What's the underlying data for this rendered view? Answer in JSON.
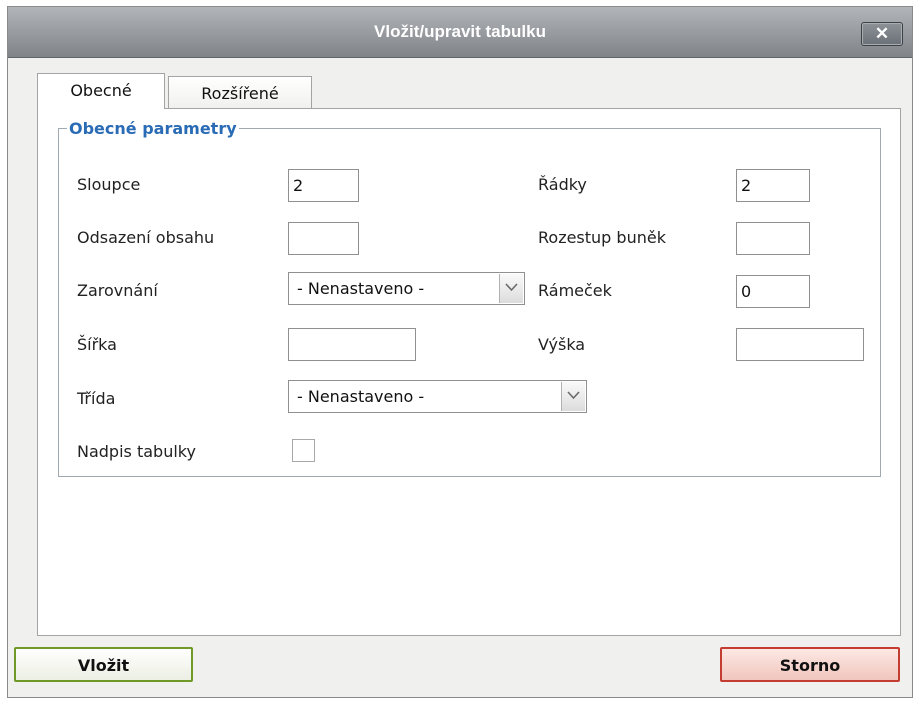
{
  "dialog": {
    "title": "Vložit/upravit tabulku",
    "close_label": "✕"
  },
  "tabs": [
    {
      "label": "Obecné",
      "active": true
    },
    {
      "label": "Rozšířené",
      "active": false
    }
  ],
  "general": {
    "legend": "Obecné parametry",
    "columns": {
      "label": "Sloupce",
      "value": "2"
    },
    "rows": {
      "label": "Řádky",
      "value": "2"
    },
    "cell_padding": {
      "label": "Odsazení obsahu",
      "value": ""
    },
    "cell_spacing": {
      "label": "Rozestup buněk",
      "value": ""
    },
    "alignment": {
      "label": "Zarovnání",
      "value": "- Nenastaveno -"
    },
    "border": {
      "label": "Rámeček",
      "value": "0"
    },
    "width": {
      "label": "Šířka",
      "value": ""
    },
    "height": {
      "label": "Výška",
      "value": ""
    },
    "class": {
      "label": "Třída",
      "value": "- Nenastaveno -"
    },
    "caption": {
      "label": "Nadpis tabulky",
      "checked": false
    }
  },
  "buttons": {
    "insert": "Vložit",
    "cancel": "Storno"
  },
  "colors": {
    "titlebar": "#8d9297",
    "legend": "#2a6bb5",
    "insert_border": "#6f9a28",
    "cancel_border": "#c43d30"
  }
}
